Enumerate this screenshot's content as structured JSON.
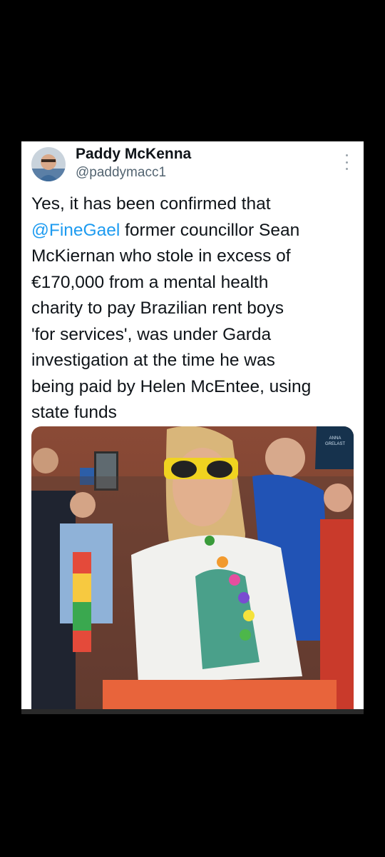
{
  "tweet": {
    "author": {
      "display_name": "Paddy McKenna",
      "handle": "@paddymacc1",
      "avatar_icon": "profile-avatar"
    },
    "more_icon": "more-options-icon",
    "text_lines": [
      {
        "pre": "Yes, it has been confirmed that",
        "mention": "",
        "post": ""
      },
      {
        "pre": "",
        "mention": "@FineGael",
        "post": " former councillor Sean"
      },
      {
        "pre": "McKiernan who stole in excess of",
        "mention": "",
        "post": ""
      },
      {
        "pre": "€170,000 from a mental  health",
        "mention": "",
        "post": ""
      },
      {
        "pre": "charity to pay Brazilian rent boys",
        "mention": "",
        "post": ""
      },
      {
        "pre": "'for services', was under Garda",
        "mention": "",
        "post": ""
      },
      {
        "pre": "investigation at the time  he was",
        "mention": "",
        "post": ""
      },
      {
        "pre": "being paid by Helen McEntee, using",
        "mention": "",
        "post": ""
      },
      {
        "pre": "state funds",
        "mention": "",
        "post": ""
      }
    ],
    "photo": {
      "sign_text": "ANNA\nGRELAST"
    }
  },
  "colors": {
    "background": "#000000",
    "card": "#ffffff",
    "text": "#0f1419",
    "secondary": "#536471",
    "mention": "#1d9bf0"
  }
}
